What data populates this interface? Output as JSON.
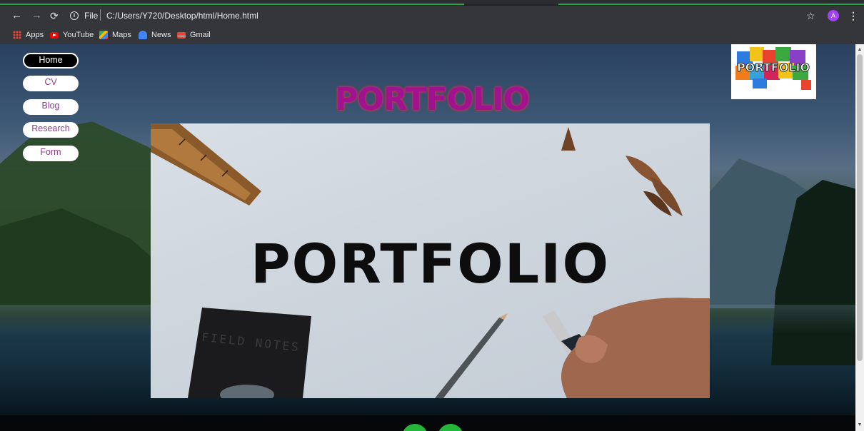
{
  "browser": {
    "address_scheme": "File",
    "address_url": "C:/Users/Y720/Desktop/html/Home.html",
    "profile_initial": "A",
    "icons": [
      "back-arrow-icon",
      "forward-arrow-icon",
      "reload-icon",
      "info-icon",
      "star-icon",
      "menu-kebab-icon"
    ],
    "bookmarks": [
      {
        "label": "Apps",
        "icon": "apps-grid-icon"
      },
      {
        "label": "YouTube",
        "icon": "youtube-icon"
      },
      {
        "label": "Maps",
        "icon": "maps-icon"
      },
      {
        "label": "News",
        "icon": "news-icon"
      },
      {
        "label": "Gmail",
        "icon": "gmail-icon"
      }
    ]
  },
  "page": {
    "nav": [
      {
        "label": "Home",
        "active": true
      },
      {
        "label": "CV",
        "active": false
      },
      {
        "label": "Blog",
        "active": false
      },
      {
        "label": "Research",
        "active": false
      },
      {
        "label": "Form",
        "active": false
      }
    ],
    "title": "PORTFOLIO",
    "logo_text": "PORTFOLIO",
    "hero_text": "PORTFOLIO",
    "hero_notebook_text": "FIELD NOTES",
    "colors": {
      "title": "#a0128f",
      "title_glow": "#d02e52",
      "nav_text": "#8d3f8a",
      "footer_button": "#25b63a",
      "progress_green": "#27a84a"
    }
  }
}
